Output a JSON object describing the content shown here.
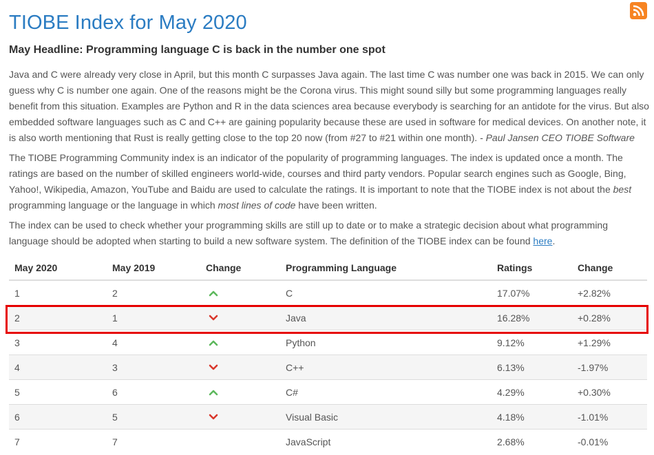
{
  "rss_icon": "rss-feed-icon",
  "title": "TIOBE Index for May 2020",
  "headline": "May Headline: Programming language C is back in the number one spot",
  "para1": {
    "text": "Java and C were already very close in April, but this month C surpasses Java again. The last time C was number one was back in 2015. We can only guess why C is number one again. One of the reasons might be the Corona virus. This might sound silly but some programming languages really benefit from this situation. Examples are Python and R in the data sciences area because everybody is searching for an antidote for the virus. But also embedded software languages such as C and C++ are gaining popularity because these are used in software for medical devices. On another note, it is also worth mentioning that Rust is really getting close to the top 20 now (from #27 to #21 within one month).",
    "signature": "- Paul Jansen CEO TIOBE Software"
  },
  "para2": {
    "part1": "The TIOBE Programming Community index is an indicator of the popularity of programming languages. The index is updated once a month. The ratings are based on the number of skilled engineers world-wide, courses and third party vendors. Popular search engines such as Google, Bing, Yahoo!, Wikipedia, Amazon, YouTube and Baidu are used to calculate the ratings. It is important to note that the TIOBE index is not about the ",
    "em1": "best",
    "part2": " programming language or the language in which ",
    "em2": "most lines of code",
    "part3": " have been written."
  },
  "para3": {
    "text": "The index can be used to check whether your programming skills are still up to date or to make a strategic decision about what programming language should be adopted when starting to build a new software system. The definition of the TIOBE index can be found ",
    "link": "here",
    "end": "."
  },
  "table": {
    "headers": [
      "May 2020",
      "May 2019",
      "Change",
      "Programming Language",
      "Ratings",
      "Change"
    ],
    "rows": [
      {
        "rank2020": "1",
        "rank2019": "2",
        "direction": "up",
        "language": "C",
        "rating": "17.07%",
        "change": "+2.82%"
      },
      {
        "rank2020": "2",
        "rank2019": "1",
        "direction": "down",
        "language": "Java",
        "rating": "16.28%",
        "change": "+0.28%"
      },
      {
        "rank2020": "3",
        "rank2019": "4",
        "direction": "up",
        "language": "Python",
        "rating": "9.12%",
        "change": "+1.29%"
      },
      {
        "rank2020": "4",
        "rank2019": "3",
        "direction": "down",
        "language": "C++",
        "rating": "6.13%",
        "change": "-1.97%"
      },
      {
        "rank2020": "5",
        "rank2019": "6",
        "direction": "up",
        "language": "C#",
        "rating": "4.29%",
        "change": "+0.30%"
      },
      {
        "rank2020": "6",
        "rank2019": "5",
        "direction": "down",
        "language": "Visual Basic",
        "rating": "4.18%",
        "change": "-1.01%"
      },
      {
        "rank2020": "7",
        "rank2019": "7",
        "direction": "none",
        "language": "JavaScript",
        "rating": "2.68%",
        "change": "-0.01%"
      }
    ]
  },
  "colors": {
    "title": "#2b7cc2",
    "up_arrow": "#5cb85c",
    "down_arrow": "#d9372c",
    "highlight_border": "#e60000",
    "rss": "#f78422"
  }
}
